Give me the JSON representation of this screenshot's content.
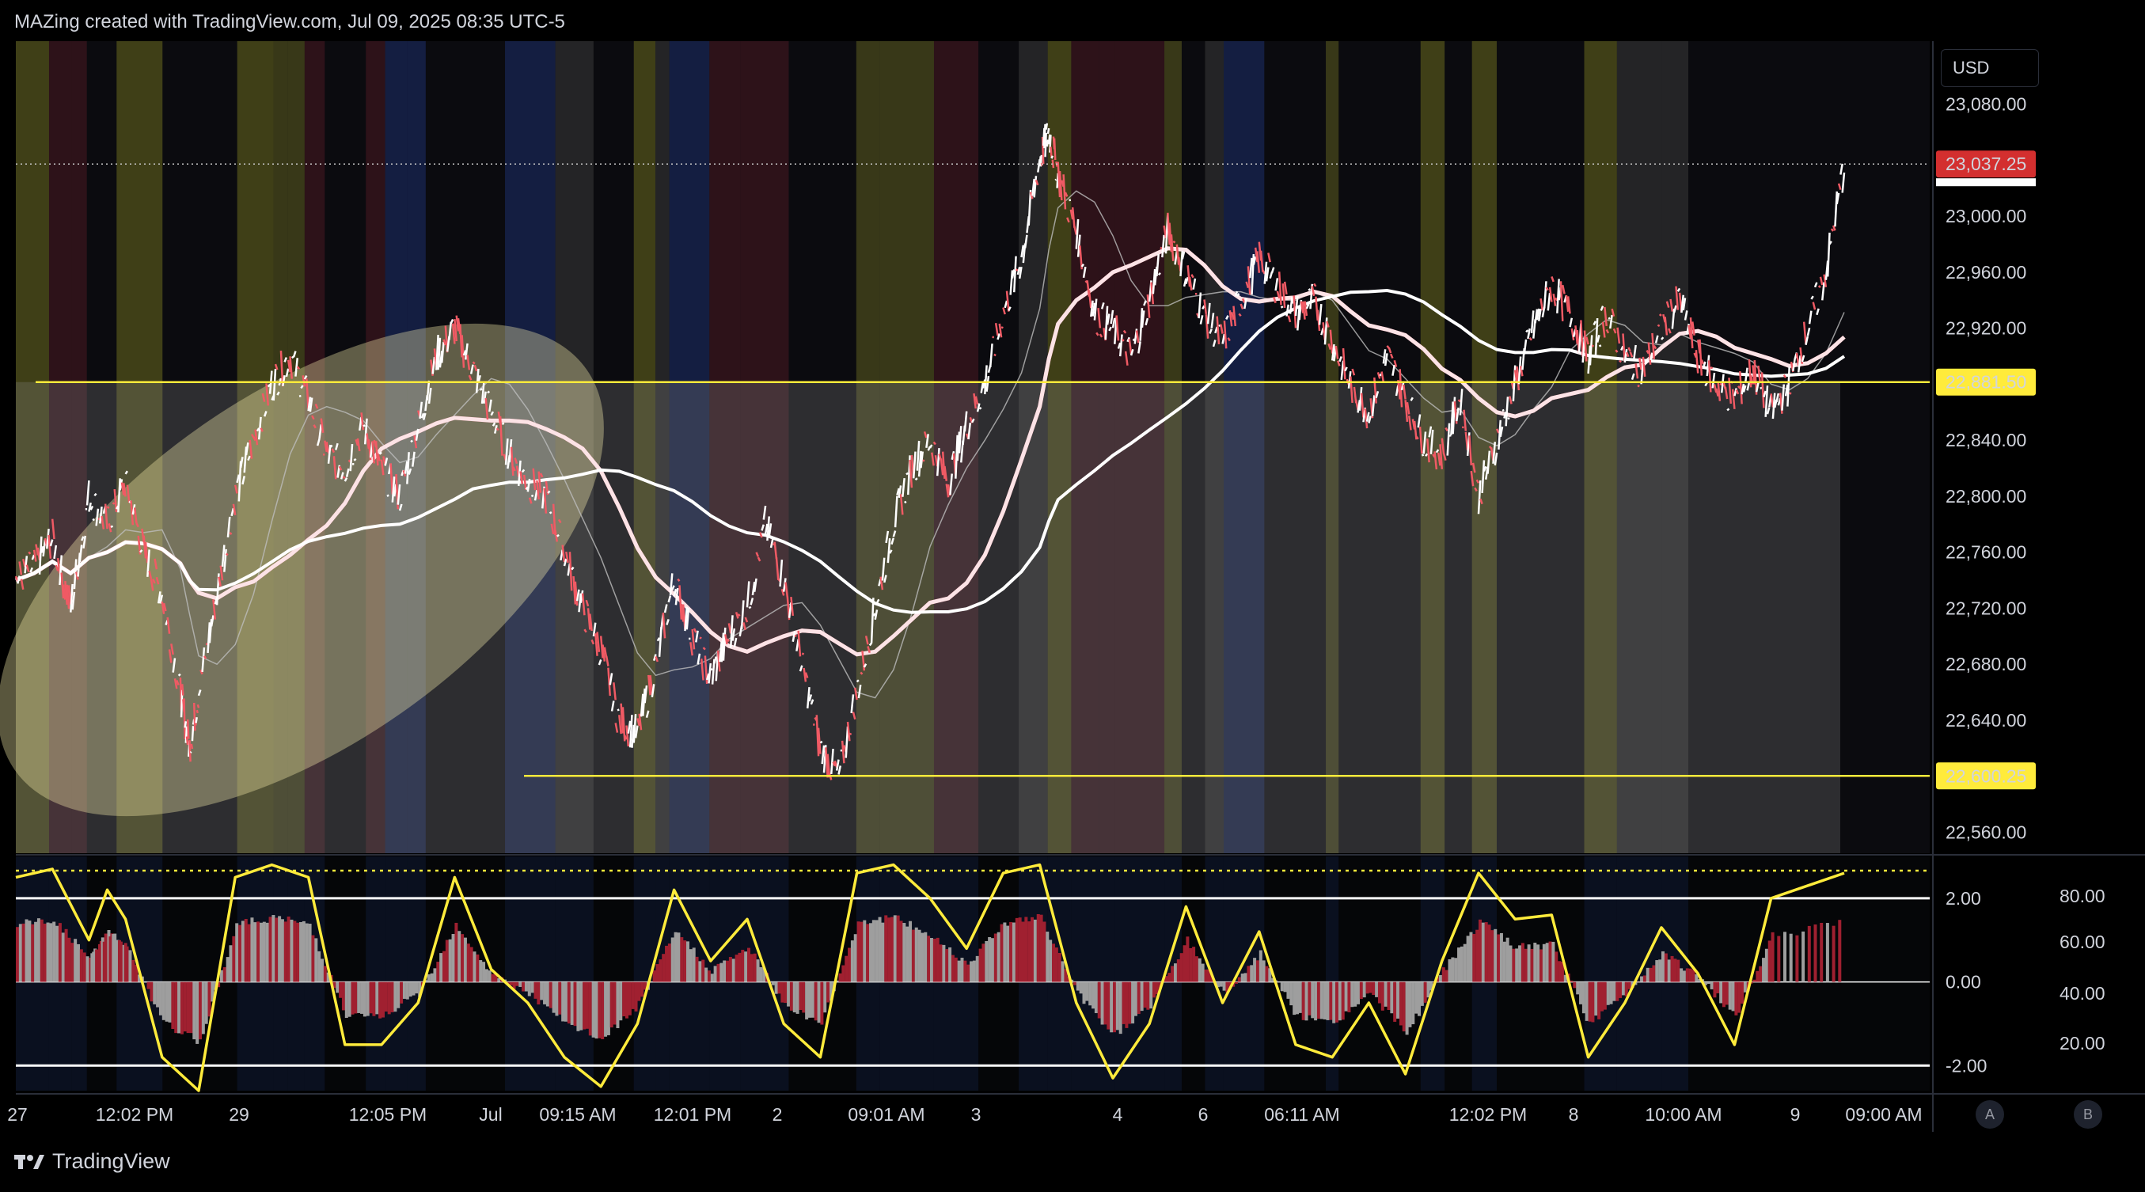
{
  "header": {
    "title": "MAZing created with TradingView.com, Jul 09, 2025 08:35 UTC-5"
  },
  "currency": "USD",
  "footer": {
    "brand": "TradingView"
  },
  "buttons": {
    "a": "A",
    "b": "B"
  },
  "colors": {
    "bull": "#ffffff",
    "bear": "#f05a64",
    "yellow": "#ffeb3b",
    "red_ma": "#e84557",
    "ellipse": "#fff5b0"
  },
  "chart_data": [
    {
      "type": "line",
      "title": "",
      "price_labels": [
        "23,080.00",
        "23,000.00",
        "22,960.00",
        "22,920.00",
        "22,840.00",
        "22,800.00",
        "22,760.00",
        "22,720.00",
        "22,680.00",
        "22,640.00",
        "22,560.00"
      ],
      "price_values": [
        23080,
        23000,
        22960,
        22920,
        22840,
        22800,
        22760,
        22720,
        22680,
        22640,
        22560
      ],
      "ylim": [
        22545,
        23125
      ],
      "current_price": {
        "label": "23,037.25",
        "value": 23037.25
      },
      "levels": [
        {
          "label": "22,881.50",
          "value": 22881.5
        },
        {
          "label": "22,600.25",
          "value": 22600.25
        }
      ],
      "time_labels": [
        "27",
        "12:02 PM",
        "29",
        "12:05 PM",
        "Jul",
        "09:15 AM",
        "12:01 PM",
        "2",
        "09:01 AM",
        "3",
        "4",
        "6",
        "06:11 AM",
        "12:02 PM",
        "8",
        "10:00 AM",
        "9",
        "09:00 AM"
      ],
      "price_path": [
        [
          0,
          22740
        ],
        [
          0.01,
          22750
        ],
        [
          0.02,
          22770
        ],
        [
          0.03,
          22720
        ],
        [
          0.04,
          22800
        ],
        [
          0.05,
          22780
        ],
        [
          0.06,
          22810
        ],
        [
          0.07,
          22760
        ],
        [
          0.08,
          22730
        ],
        [
          0.09,
          22660
        ],
        [
          0.095,
          22620
        ],
        [
          0.1,
          22660
        ],
        [
          0.11,
          22730
        ],
        [
          0.12,
          22800
        ],
        [
          0.13,
          22840
        ],
        [
          0.14,
          22880
        ],
        [
          0.15,
          22900
        ],
        [
          0.16,
          22870
        ],
        [
          0.17,
          22830
        ],
        [
          0.18,
          22820
        ],
        [
          0.19,
          22850
        ],
        [
          0.2,
          22820
        ],
        [
          0.21,
          22800
        ],
        [
          0.22,
          22850
        ],
        [
          0.23,
          22900
        ],
        [
          0.24,
          22920
        ],
        [
          0.25,
          22890
        ],
        [
          0.26,
          22860
        ],
        [
          0.27,
          22830
        ],
        [
          0.28,
          22810
        ],
        [
          0.29,
          22800
        ],
        [
          0.3,
          22760
        ],
        [
          0.31,
          22720
        ],
        [
          0.32,
          22690
        ],
        [
          0.33,
          22640
        ],
        [
          0.34,
          22630
        ],
        [
          0.35,
          22680
        ],
        [
          0.36,
          22740
        ],
        [
          0.37,
          22700
        ],
        [
          0.38,
          22670
        ],
        [
          0.39,
          22700
        ],
        [
          0.4,
          22720
        ],
        [
          0.41,
          22780
        ],
        [
          0.42,
          22740
        ],
        [
          0.43,
          22680
        ],
        [
          0.44,
          22620
        ],
        [
          0.45,
          22600
        ],
        [
          0.46,
          22660
        ],
        [
          0.47,
          22720
        ],
        [
          0.48,
          22780
        ],
        [
          0.49,
          22820
        ],
        [
          0.5,
          22840
        ],
        [
          0.51,
          22810
        ],
        [
          0.52,
          22850
        ],
        [
          0.53,
          22880
        ],
        [
          0.54,
          22930
        ],
        [
          0.55,
          22970
        ],
        [
          0.56,
          23040
        ],
        [
          0.565,
          23060
        ],
        [
          0.57,
          23030
        ],
        [
          0.58,
          22990
        ],
        [
          0.59,
          22930
        ],
        [
          0.6,
          22920
        ],
        [
          0.61,
          22900
        ],
        [
          0.62,
          22940
        ],
        [
          0.63,
          22990
        ],
        [
          0.64,
          22960
        ],
        [
          0.65,
          22930
        ],
        [
          0.66,
          22910
        ],
        [
          0.67,
          22940
        ],
        [
          0.68,
          22970
        ],
        [
          0.69,
          22950
        ],
        [
          0.7,
          22930
        ],
        [
          0.71,
          22940
        ],
        [
          0.72,
          22910
        ],
        [
          0.73,
          22880
        ],
        [
          0.74,
          22860
        ],
        [
          0.75,
          22900
        ],
        [
          0.76,
          22870
        ],
        [
          0.77,
          22840
        ],
        [
          0.78,
          22830
        ],
        [
          0.79,
          22870
        ],
        [
          0.8,
          22800
        ],
        [
          0.81,
          22840
        ],
        [
          0.82,
          22880
        ],
        [
          0.83,
          22920
        ],
        [
          0.84,
          22950
        ],
        [
          0.85,
          22930
        ],
        [
          0.86,
          22900
        ],
        [
          0.87,
          22930
        ],
        [
          0.88,
          22900
        ],
        [
          0.89,
          22890
        ],
        [
          0.9,
          22920
        ],
        [
          0.91,
          22940
        ],
        [
          0.92,
          22900
        ],
        [
          0.93,
          22880
        ],
        [
          0.94,
          22870
        ],
        [
          0.95,
          22890
        ],
        [
          0.96,
          22860
        ],
        [
          0.97,
          22880
        ],
        [
          0.98,
          22920
        ],
        [
          0.99,
          22960
        ],
        [
          1.0,
          23037
        ]
      ]
    },
    {
      "type": "line",
      "title": "",
      "left_axis_labels": [
        "2.00",
        "0.00",
        "-2.00"
      ],
      "left_axis_values": [
        2,
        0,
        -2
      ],
      "right_axis_labels": [
        "80.00",
        "60.00",
        "40.00",
        "20.00"
      ],
      "ylim": [
        -2.6,
        3.0
      ],
      "oscillator": [
        [
          0,
          2.5
        ],
        [
          0.02,
          2.7
        ],
        [
          0.04,
          1.0
        ],
        [
          0.05,
          2.2
        ],
        [
          0.06,
          1.5
        ],
        [
          0.08,
          -1.8
        ],
        [
          0.1,
          -2.6
        ],
        [
          0.12,
          2.5
        ],
        [
          0.14,
          2.8
        ],
        [
          0.16,
          2.5
        ],
        [
          0.18,
          -1.5
        ],
        [
          0.2,
          -1.5
        ],
        [
          0.22,
          -0.5
        ],
        [
          0.24,
          2.5
        ],
        [
          0.26,
          0.3
        ],
        [
          0.28,
          -0.5
        ],
        [
          0.3,
          -1.8
        ],
        [
          0.32,
          -2.5
        ],
        [
          0.34,
          -1.0
        ],
        [
          0.36,
          2.2
        ],
        [
          0.38,
          0.5
        ],
        [
          0.4,
          1.5
        ],
        [
          0.42,
          -1.0
        ],
        [
          0.44,
          -1.8
        ],
        [
          0.46,
          2.6
        ],
        [
          0.48,
          2.8
        ],
        [
          0.5,
          2.0
        ],
        [
          0.52,
          0.8
        ],
        [
          0.54,
          2.6
        ],
        [
          0.56,
          2.8
        ],
        [
          0.58,
          -0.5
        ],
        [
          0.6,
          -2.3
        ],
        [
          0.62,
          -1.0
        ],
        [
          0.64,
          1.8
        ],
        [
          0.66,
          -0.5
        ],
        [
          0.68,
          1.2
        ],
        [
          0.7,
          -1.5
        ],
        [
          0.72,
          -1.8
        ],
        [
          0.74,
          -0.5
        ],
        [
          0.76,
          -2.2
        ],
        [
          0.78,
          0.5
        ],
        [
          0.8,
          2.6
        ],
        [
          0.82,
          1.5
        ],
        [
          0.84,
          1.6
        ],
        [
          0.86,
          -1.8
        ],
        [
          0.88,
          -0.5
        ],
        [
          0.9,
          1.3
        ],
        [
          0.92,
          0.2
        ],
        [
          0.94,
          -1.5
        ],
        [
          0.96,
          2.0
        ],
        [
          1.0,
          2.6
        ]
      ]
    }
  ]
}
